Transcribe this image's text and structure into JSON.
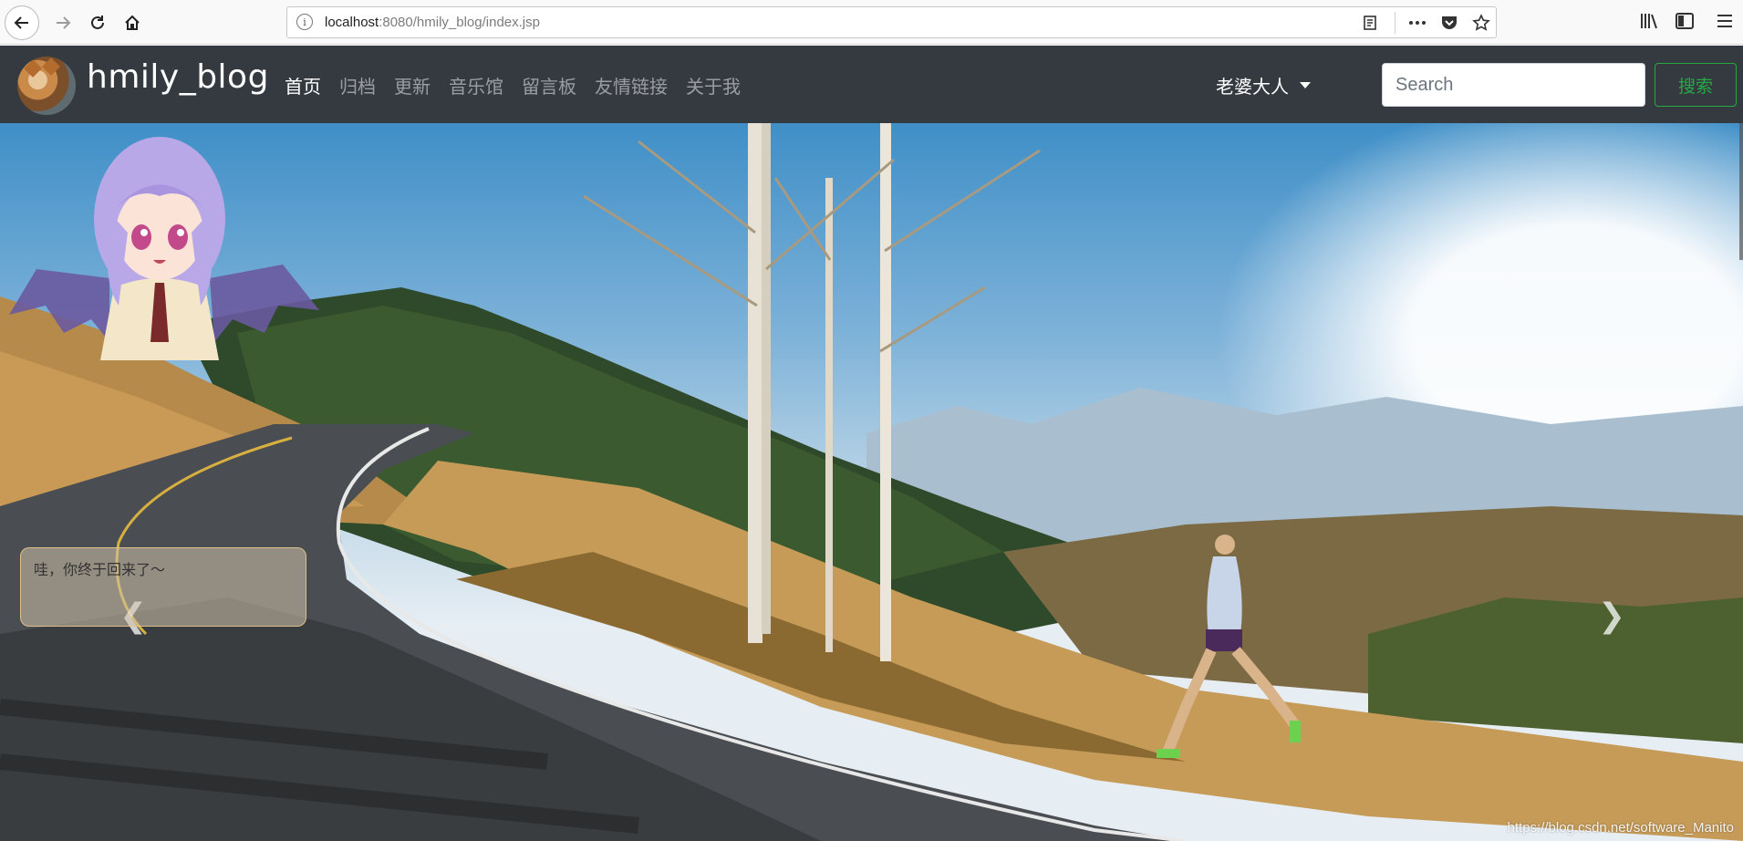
{
  "browser": {
    "url_host": "localhost",
    "url_path": ":8080/hmily_blog/index.jsp",
    "icons": [
      "back-icon",
      "forward-icon",
      "reload-icon",
      "home-icon",
      "info-icon",
      "reader-view-icon",
      "more-icon",
      "pocket-icon",
      "bookmark-star-icon",
      "library-icon",
      "sidebar-icon",
      "menu-icon"
    ]
  },
  "navbar": {
    "brand": "hmily_blog",
    "links": [
      {
        "label": "首页",
        "active": true
      },
      {
        "label": "归档",
        "active": false
      },
      {
        "label": "更新",
        "active": false
      },
      {
        "label": "音乐馆",
        "active": false
      },
      {
        "label": "留言板",
        "active": false
      },
      {
        "label": "友情链接",
        "active": false
      },
      {
        "label": "关于我",
        "active": false
      }
    ],
    "user_menu": "老婆大人",
    "search_placeholder": "Search",
    "search_button": "搜索"
  },
  "hero": {
    "prev_symbol": "❮",
    "next_symbol": "❯"
  },
  "mascot": {
    "speech": "哇，你终于回来了～"
  },
  "watermark": "https://blog.csdn.net/software_Manito",
  "colors": {
    "navbar_bg": "#343a40",
    "search_button": "#28a745"
  }
}
